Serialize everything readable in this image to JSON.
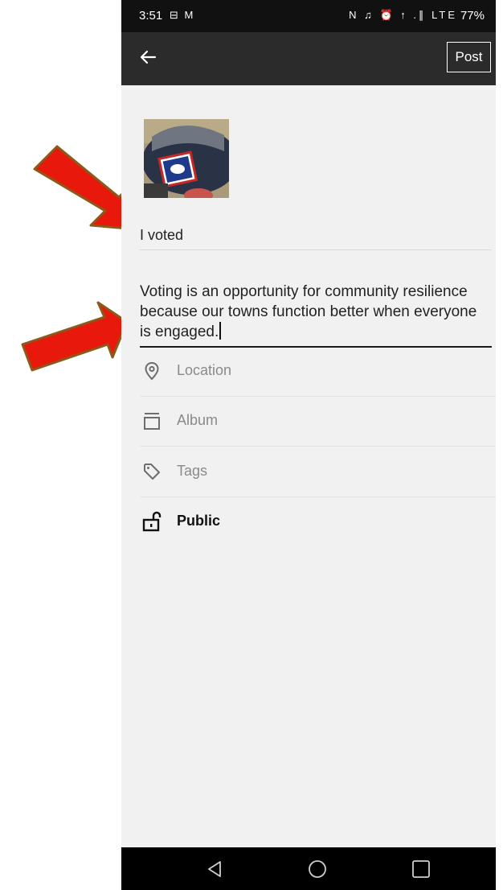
{
  "status_bar": {
    "time": "3:51",
    "left_icons": "⊟ M",
    "right_icons": "N ♫ ⏰ ↑ .∥ LTE",
    "battery": "77%"
  },
  "app_bar": {
    "post_label": "Post"
  },
  "post": {
    "title": "I voted",
    "caption": "Voting is an opportunity for community resilience because our towns function better when everyone is engaged."
  },
  "options": {
    "location": {
      "label": "Location",
      "icon": "location-pin-icon"
    },
    "album": {
      "label": "Album",
      "icon": "album-icon"
    },
    "tags": {
      "label": "Tags",
      "icon": "tag-icon"
    },
    "visibility": {
      "label": "Public",
      "icon": "unlocked-icon"
    }
  },
  "colors": {
    "arrow_fill": "#e8180c",
    "arrow_stroke": "#8a5a1a",
    "app_bar": "#2b2b2b",
    "background": "#f1f1f1"
  }
}
